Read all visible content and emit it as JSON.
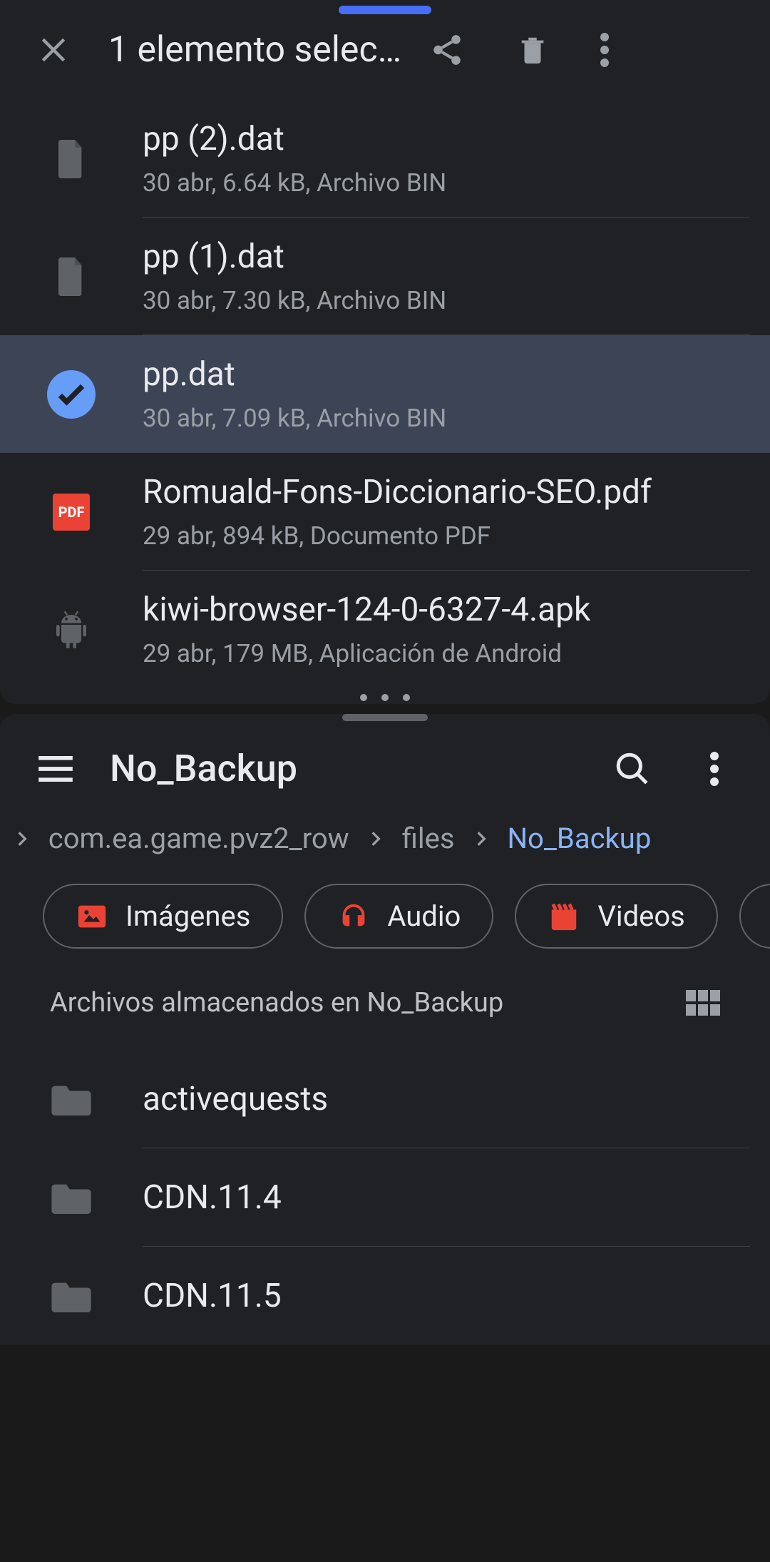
{
  "topPane": {
    "title": "1 elemento selec…",
    "files": [
      {
        "name": "pp (2).dat",
        "meta": "30 abr, 6.64 kB, Archivo BIN",
        "icon": "file",
        "selected": false
      },
      {
        "name": "pp (1).dat",
        "meta": "30 abr, 7.30 kB, Archivo BIN",
        "icon": "file",
        "selected": false
      },
      {
        "name": "pp.dat",
        "meta": "30 abr, 7.09 kB, Archivo BIN",
        "icon": "check",
        "selected": true
      },
      {
        "name": "Romuald-Fons-Diccionario-SEO.pdf",
        "meta": "29 abr, 894 kB, Documento PDF",
        "icon": "pdf",
        "selected": false
      },
      {
        "name": "kiwi-browser-124-0-6327-4.apk",
        "meta": "29 abr, 179 MB, Aplicación de Android",
        "icon": "android",
        "selected": false
      }
    ]
  },
  "bottomPane": {
    "title": "No_Backup",
    "breadcrumb": {
      "cutLeading": "a",
      "items": [
        "com.ea.game.pvz2_row",
        "files",
        "No_Backup"
      ]
    },
    "chips": [
      "Imágenes",
      "Audio",
      "Videos"
    ],
    "sectionLabel": "Archivos almacenados en No_Backup",
    "folders": [
      "activequests",
      "CDN.11.4",
      "CDN.11.5"
    ],
    "pdfBadge": "PDF"
  }
}
